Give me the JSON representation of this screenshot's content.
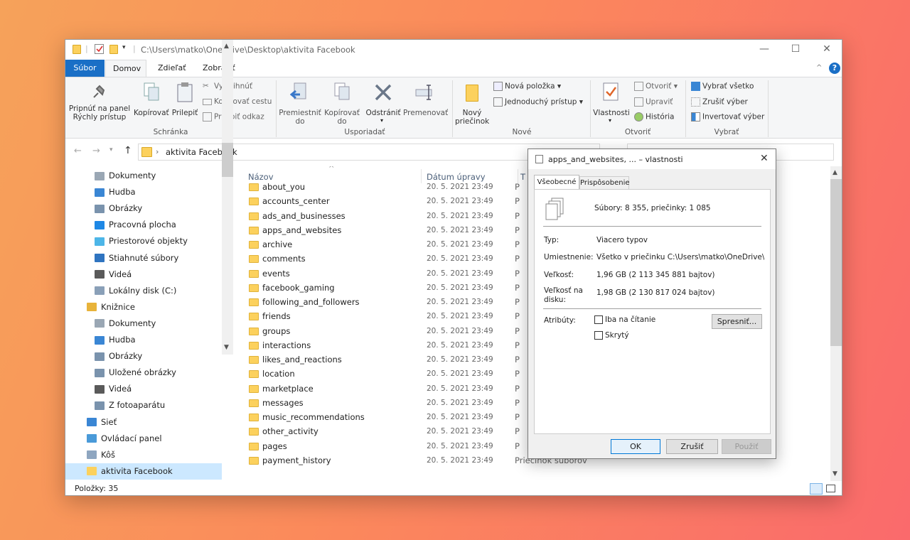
{
  "window": {
    "title_path": "C:\\Users\\matko\\OneDrive\\Desktop\\aktivita Facebook",
    "minimize": "—",
    "maximize": "☐",
    "close": "✕"
  },
  "tabs": [
    "Súbor",
    "Domov",
    "Zdieľať",
    "Zobraziť"
  ],
  "ribbon": {
    "pin": "Pripnúť na panel Rýchly prístup",
    "copy": "Kopírovať",
    "paste": "Prilepiť",
    "cut": "Vystrihnúť",
    "copy_path": "Kopírovať cestu",
    "paste_shortcut": "Prilepiť odkaz",
    "clipboard_group": "Schránka",
    "move_to": "Premiestniť do",
    "copy_to": "Kopírovať do",
    "delete": "Odstrániť",
    "rename": "Premenovať",
    "organize_group": "Usporiadať",
    "new_folder": "Nový priečinok",
    "new_item": "Nová položka",
    "easy_access": "Jednoduchý prístup",
    "new_group": "Nové",
    "properties": "Vlastnosti",
    "open": "Otvoriť",
    "edit": "Upraviť",
    "history": "História",
    "open_group": "Otvoriť",
    "select_all": "Vybrať všetko",
    "select_none": "Zrušiť výber",
    "invert_selection": "Invertovať výber",
    "select_group": "Vybrať"
  },
  "address": {
    "current": "aktivita Facebook"
  },
  "nav": [
    {
      "label": "Dokumenty",
      "icon": "documents-icon",
      "indent": 2
    },
    {
      "label": "Hudba",
      "icon": "music-icon",
      "indent": 2
    },
    {
      "label": "Obrázky",
      "icon": "pictures-icon",
      "indent": 2
    },
    {
      "label": "Pracovná plocha",
      "icon": "desktop-icon",
      "indent": 2
    },
    {
      "label": "Priestorové objekty",
      "icon": "3d-objects-icon",
      "indent": 2
    },
    {
      "label": "Stiahnuté súbory",
      "icon": "downloads-icon",
      "indent": 2
    },
    {
      "label": "Videá",
      "icon": "videos-icon",
      "indent": 2
    },
    {
      "label": "Lokálny disk (C:)",
      "icon": "drive-icon",
      "indent": 2
    },
    {
      "label": "Knižnice",
      "icon": "libraries-icon",
      "indent": 1
    },
    {
      "label": "Dokumenty",
      "icon": "documents-icon",
      "indent": 2
    },
    {
      "label": "Hudba",
      "icon": "music-icon",
      "indent": 2
    },
    {
      "label": "Obrázky",
      "icon": "pictures-icon",
      "indent": 2
    },
    {
      "label": "Uložené obrázky",
      "icon": "saved-pictures-icon",
      "indent": 2
    },
    {
      "label": "Videá",
      "icon": "videos-icon",
      "indent": 2
    },
    {
      "label": "Z fotoaparátu",
      "icon": "camera-roll-icon",
      "indent": 2
    },
    {
      "label": "Sieť",
      "icon": "network-icon",
      "indent": 1
    },
    {
      "label": "Ovládací panel",
      "icon": "control-panel-icon",
      "indent": 1
    },
    {
      "label": "Kôš",
      "icon": "recycle-bin-icon",
      "indent": 1
    },
    {
      "label": "aktivita Facebook",
      "icon": "folder-icon",
      "indent": 1,
      "selected": true
    }
  ],
  "columns": {
    "name": "Názov",
    "date": "Dátum úpravy",
    "type": "T"
  },
  "files": [
    {
      "name": "about_you",
      "date": "20. 5. 2021 23:49",
      "type": "P"
    },
    {
      "name": "accounts_center",
      "date": "20. 5. 2021 23:49",
      "type": "P"
    },
    {
      "name": "ads_and_businesses",
      "date": "20. 5. 2021 23:49",
      "type": "P"
    },
    {
      "name": "apps_and_websites",
      "date": "20. 5. 2021 23:49",
      "type": "P"
    },
    {
      "name": "archive",
      "date": "20. 5. 2021 23:49",
      "type": "P"
    },
    {
      "name": "comments",
      "date": "20. 5. 2021 23:49",
      "type": "P"
    },
    {
      "name": "events",
      "date": "20. 5. 2021 23:49",
      "type": "P"
    },
    {
      "name": "facebook_gaming",
      "date": "20. 5. 2021 23:49",
      "type": "P"
    },
    {
      "name": "following_and_followers",
      "date": "20. 5. 2021 23:49",
      "type": "P"
    },
    {
      "name": "friends",
      "date": "20. 5. 2021 23:49",
      "type": "P"
    },
    {
      "name": "groups",
      "date": "20. 5. 2021 23:49",
      "type": "P"
    },
    {
      "name": "interactions",
      "date": "20. 5. 2021 23:49",
      "type": "P"
    },
    {
      "name": "likes_and_reactions",
      "date": "20. 5. 2021 23:49",
      "type": "P"
    },
    {
      "name": "location",
      "date": "20. 5. 2021 23:49",
      "type": "P"
    },
    {
      "name": "marketplace",
      "date": "20. 5. 2021 23:49",
      "type": "P"
    },
    {
      "name": "messages",
      "date": "20. 5. 2021 23:49",
      "type": "P"
    },
    {
      "name": "music_recommendations",
      "date": "20. 5. 2021 23:49",
      "type": "P"
    },
    {
      "name": "other_activity",
      "date": "20. 5. 2021 23:49",
      "type": "P"
    },
    {
      "name": "pages",
      "date": "20. 5. 2021 23:49",
      "type": "P"
    },
    {
      "name": "payment_history",
      "date": "20. 5. 2021 23:49",
      "type": "Priečinok súborov"
    }
  ],
  "status": {
    "items": "Položky: 35"
  },
  "dialog": {
    "title": "apps_and_websites, ... – vlastnosti",
    "tab_general": "Všeobecné",
    "tab_customize": "Prispôsobenie",
    "summary": "Súbory: 8 355, priečinky: 1 085",
    "type_label": "Typ:",
    "type_value": "Viacero typov",
    "location_label": "Umiestnenie:",
    "location_value": "Všetko v priečinku C:\\Users\\matko\\OneDrive\\Deskt",
    "size_label": "Veľkosť:",
    "size_value": "1,96 GB (2 113 345 881 bajtov)",
    "disk_label_1": "Veľkosť na",
    "disk_label_2": "disku:",
    "disk_value": "1,98 GB (2 130 817 024 bajtov)",
    "attributes_label": "Atribúty:",
    "readonly_label": "Iba na čítanie",
    "hidden_label": "Skrytý",
    "advanced_button": "Spresniť...",
    "ok": "OK",
    "cancel": "Zrušiť",
    "apply": "Použiť"
  }
}
